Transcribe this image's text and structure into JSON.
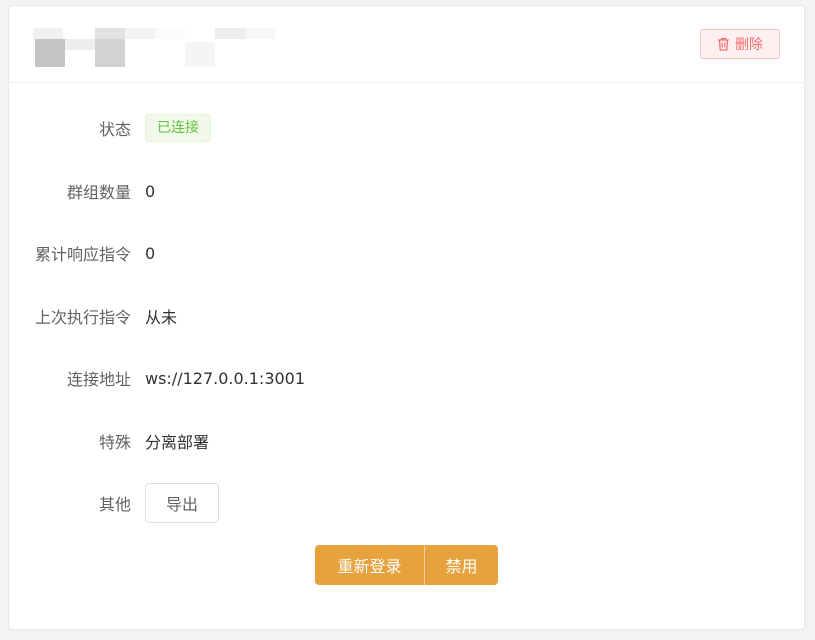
{
  "header": {
    "delete_label": "删除"
  },
  "fields": [
    {
      "label": "状态",
      "value": "已连接"
    },
    {
      "label": "群组数量",
      "value": "0"
    },
    {
      "label": "累计响应指令",
      "value": "0"
    },
    {
      "label": "上次执行指令",
      "value": "从未"
    },
    {
      "label": "连接地址",
      "value": "ws://127.0.0.1:3001"
    },
    {
      "label": "特殊",
      "value": "分离部署"
    },
    {
      "label": "其他",
      "value": "导出"
    }
  ],
  "actions": {
    "relogin_label": "重新登录",
    "disable_label": "禁用"
  },
  "colors": {
    "success": "#67c23a",
    "danger": "#f56c6c",
    "warning": "#e6a23c"
  },
  "icons": {
    "delete": "trash-icon"
  }
}
